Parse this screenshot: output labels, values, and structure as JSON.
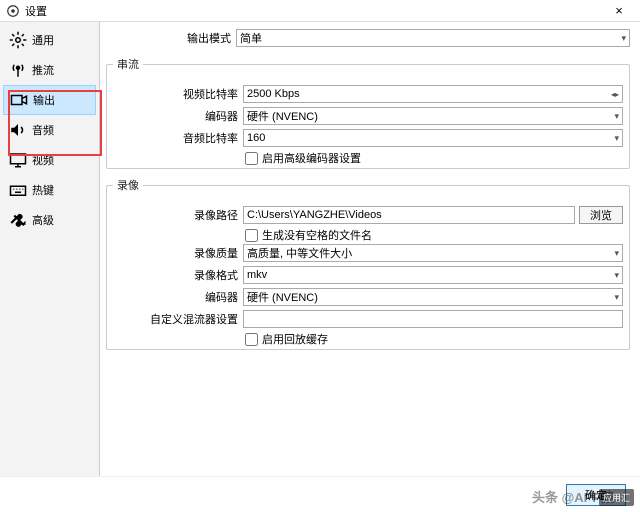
{
  "window": {
    "title": "设置",
    "close": "×"
  },
  "sidebar": {
    "items": [
      {
        "label": "通用"
      },
      {
        "label": "推流"
      },
      {
        "label": "输出"
      },
      {
        "label": "音频"
      },
      {
        "label": "视频"
      },
      {
        "label": "热键"
      },
      {
        "label": "高级"
      }
    ]
  },
  "main": {
    "output_mode_label": "输出模式",
    "output_mode_value": "简单",
    "stream_legend": "串流",
    "video_bitrate_label": "视频比特率",
    "video_bitrate_value": "2500 Kbps",
    "encoder_label": "编码器",
    "encoder_value": "硬件 (NVENC)",
    "audio_bitrate_label": "音频比特率",
    "audio_bitrate_value": "160",
    "adv_encoder_cb": "启用高级编码器设置",
    "record_legend": "录像",
    "record_path_label": "录像路径",
    "record_path_value": "C:\\Users\\YANGZHE\\Videos",
    "browse_label": "浏览",
    "no_space_cb": "生成没有空格的文件名",
    "record_quality_label": "录像质量",
    "record_quality_value": "高质量, 中等文件大小",
    "record_format_label": "录像格式",
    "record_format_value": "mkv",
    "record_encoder_label": "编码器",
    "record_encoder_value": "硬件 (NVENC)",
    "custom_mux_label": "自定义混流器设置",
    "custom_mux_value": "",
    "replay_cb": "启用回放缓存"
  },
  "footer": {
    "ok": "确定"
  },
  "watermark": "头条 @APP猿",
  "watermark2": "应用汇"
}
